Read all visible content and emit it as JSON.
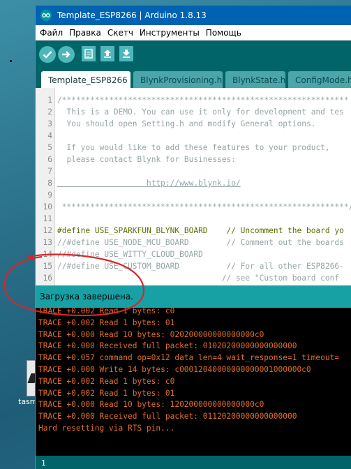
{
  "desktop": {
    "icon_label": "tasm"
  },
  "window": {
    "title": "Template_ESP8266 | Arduino 1.8.13"
  },
  "menu": [
    "Файл",
    "Правка",
    "Скетч",
    "Инструменты",
    "Помощь"
  ],
  "toolbar": {
    "buttons": [
      "verify-icon",
      "upload-icon",
      "new-icon",
      "open-icon",
      "save-icon"
    ]
  },
  "tabs": [
    "Template_ESP8266",
    "BlynkProvisioning.h",
    "BlynkState.h",
    "ConfigMode.h"
  ],
  "editor": {
    "lines": [
      {
        "n": "1",
        "text": "/*************************************************************"
      },
      {
        "n": "2",
        "text": "  This is a DEMO. You can use it only for development and tes"
      },
      {
        "n": "3",
        "text": "  You should open Setting.h and modify General options."
      },
      {
        "n": "4",
        "text": ""
      },
      {
        "n": "5",
        "text": "  If you would like to add these features to your product,"
      },
      {
        "n": "6",
        "text": "  please contact Blynk for Businesses:"
      },
      {
        "n": "7",
        "text": ""
      },
      {
        "n": "8",
        "text": "                   http://www.blynk.io/"
      },
      {
        "n": "9",
        "text": ""
      },
      {
        "n": "10",
        "text": " *************************************************************/"
      },
      {
        "n": "11",
        "text": ""
      },
      {
        "n": "12",
        "text": "#define USE_SPARKFUN_BLYNK_BOARD    // Uncomment the board yo"
      },
      {
        "n": "13",
        "text": "//#define USE_NODE_MCU_BOARD        // Comment out the boards"
      },
      {
        "n": "14",
        "text": "//#define USE_WITTY_CLOUD_BOARD"
      },
      {
        "n": "15",
        "text": "//#define USE_CUSTOM_BOARD          // For all other ESP8266-"
      },
      {
        "n": "16",
        "text": "                                   // see \"Custom board conf"
      }
    ]
  },
  "status": {
    "text": "Загрузка завершена."
  },
  "console": {
    "lines": [
      "TRACE +0.002 Read 1 bytes: c0",
      "TRACE +0.002 Read 1 bytes: 01",
      "TRACE +0.000 Read 10 bytes: 020200000000000000c0",
      "TRACE +0.000 Received full packet: 01020200000000000000",
      "TRACE +0.057 command op=0x12 data len=4 wait_response=1 timeout=",
      "TRACE +0.000 Write 14 bytes: c00012040000000000001000000c0",
      "TRACE +0.002 Read 1 bytes: c0",
      "TRACE +0.002 Read 1 bytes: 01",
      "TRACE +0.000 Read 10 bytes: 120200000000000000c0",
      "TRACE +0.000 Received full packet: 01120200000000000000",
      "Hard resetting via RTS pin..."
    ]
  },
  "bottom": {
    "line_number": "1"
  },
  "colors": {
    "titlebar": "#0063b1",
    "toolbar": "#006468",
    "status": "#17a1a5",
    "console_text": "#e26d28",
    "annotation": "#d9252a"
  }
}
